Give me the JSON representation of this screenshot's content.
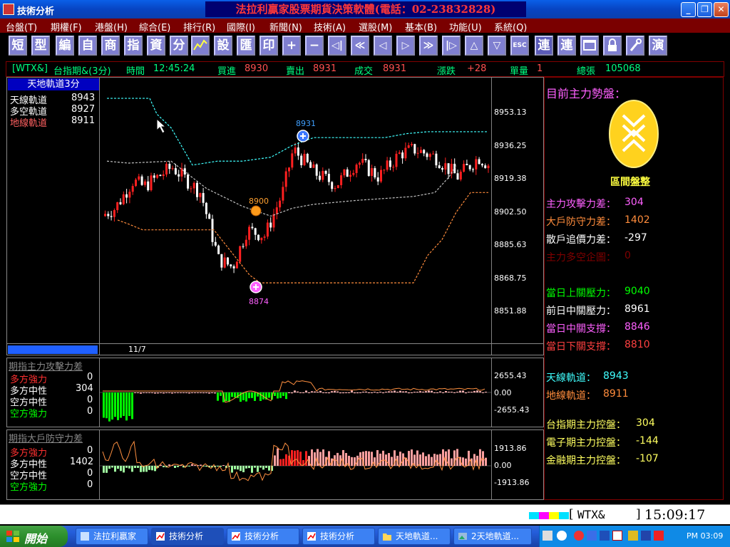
{
  "window": {
    "title": "技術分析",
    "banner": "法拉利贏家股票期貨決策軟體(電話：02-23832828)",
    "controls": [
      "_",
      "❐",
      "✕"
    ]
  },
  "menu": [
    "台盤(T)",
    "期權(F)",
    "港盤(H)",
    "綜合(E)",
    "排行(R)",
    "國際(I)",
    "新聞(N)",
    "技術(A)",
    "選股(M)",
    "基本(B)",
    "功能(U)",
    "系統(Q)"
  ],
  "toolbar": {
    "text_buttons": [
      "短",
      "型",
      "編",
      "自",
      "商",
      "指",
      "資",
      "分"
    ],
    "text_buttons2": [
      "設",
      "匯",
      "印"
    ],
    "arrows": [
      "+",
      "−",
      "◁|",
      "≪",
      "◁",
      "▷",
      "≫",
      "|▷",
      "△",
      "▽"
    ],
    "esc": "ESC",
    "right_buttons": [
      "連",
      "連",
      "演"
    ]
  },
  "status": {
    "symbol": "[WTX&]",
    "name": "台指期&(3分)",
    "time_label": "時間",
    "time": "12:45:24",
    "buy_label": "買進",
    "buy": "8930",
    "sell_label": "賣出",
    "sell": "8931",
    "trade_label": "成交",
    "trade": "8931",
    "change_label": "漲跌",
    "change": "+28",
    "volume_label": "單量",
    "volume": "1",
    "total_label": "總張",
    "total": "105068"
  },
  "main_panel": {
    "title": "天地軌道3分",
    "rows": [
      {
        "label": "天線軌道",
        "value": "8943"
      },
      {
        "label": "多空軌道",
        "value": "8927"
      },
      {
        "label": "地線軌道",
        "value": "8911"
      }
    ],
    "date": "11/7",
    "y_ticks": [
      "8953.13",
      "8936.25",
      "8919.38",
      "8902.50",
      "8885.63",
      "8868.75",
      "8851.88"
    ],
    "markers": {
      "high": "8931",
      "mid": "8900",
      "low": "8874"
    }
  },
  "attack_panel": {
    "title": "期指主力攻擊力差",
    "rows": [
      {
        "label": "多方強力",
        "value": "0"
      },
      {
        "label": "多方中性",
        "value": "304"
      },
      {
        "label": "空方中性",
        "value": "0"
      },
      {
        "label": "空方強力",
        "value": "0"
      }
    ],
    "y_ticks": [
      "2655.43",
      "0.00",
      "-2655.43"
    ]
  },
  "defense_panel": {
    "title": "期指大戶防守力差",
    "rows": [
      {
        "label": "多方強力",
        "value": "0"
      },
      {
        "label": "多方中性",
        "value": "1402"
      },
      {
        "label": "空方中性",
        "value": "0"
      },
      {
        "label": "空方強力",
        "value": "0"
      }
    ],
    "y_ticks": [
      "1913.86",
      "0.00",
      "-1913.86"
    ]
  },
  "right_panel": {
    "heading": "目前主力勢盤：",
    "trend": "區間盤整",
    "force": [
      {
        "label": "主力攻擊力差：",
        "value": "304"
      },
      {
        "label": "大戶防守力差：",
        "value": "1402"
      },
      {
        "label": "散戶追價力差：",
        "value": "-297"
      },
      {
        "label": "主力多空企圖：",
        "value": "0"
      }
    ],
    "levels": [
      {
        "label": "當日上關壓力：",
        "value": "9040"
      },
      {
        "label": "前日中關壓力：",
        "value": "8961"
      },
      {
        "label": "當日中關支撐：",
        "value": "8846"
      },
      {
        "label": "當日下關支撐：",
        "value": "8810"
      }
    ],
    "rails": [
      {
        "label": "天線軌道：",
        "value": "8943"
      },
      {
        "label": "地線軌道：",
        "value": "8911"
      }
    ],
    "control": [
      {
        "label": "台指期主力控盤：",
        "value": "304"
      },
      {
        "label": "電子期主力控盤：",
        "value": "-144"
      },
      {
        "label": "金融期主力控盤：",
        "value": "-107"
      }
    ]
  },
  "bottom": {
    "symbol": "WTX&",
    "clock": "15:09:17"
  },
  "taskbar": {
    "start": "開始",
    "tasks": [
      "法拉利贏家",
      "技術分析",
      "技術分析",
      "技術分析",
      "天地軌道...",
      "2天地軌道..."
    ],
    "tray_time": "PM 03:09"
  },
  "colors": {
    "bull": "#ff2020",
    "bear": "#ffffff",
    "green": "#00ff00",
    "pink": "#ff55ff",
    "orange": "#ff8c3c",
    "cyan": "#40ffff"
  }
}
